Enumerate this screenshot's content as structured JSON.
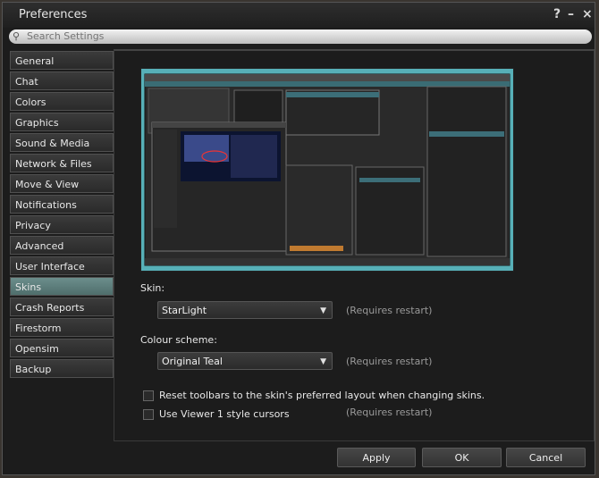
{
  "window": {
    "title": "Preferences",
    "help_button": "?",
    "minimize_button": "–",
    "close_button": "×"
  },
  "search": {
    "placeholder": "Search Settings"
  },
  "sidebar": {
    "tabs": [
      {
        "label": "General"
      },
      {
        "label": "Chat"
      },
      {
        "label": "Colors"
      },
      {
        "label": "Graphics"
      },
      {
        "label": "Sound & Media"
      },
      {
        "label": "Network & Files"
      },
      {
        "label": "Move & View"
      },
      {
        "label": "Notifications"
      },
      {
        "label": "Privacy"
      },
      {
        "label": "Advanced"
      },
      {
        "label": "User Interface"
      },
      {
        "label": "Skins"
      },
      {
        "label": "Crash Reports"
      },
      {
        "label": "Firestorm"
      },
      {
        "label": "Opensim"
      },
      {
        "label": "Backup"
      }
    ],
    "active": "Skins"
  },
  "skins_panel": {
    "skin_label": "Skin:",
    "skin_value": "StarLight",
    "skin_note": "(Requires restart)",
    "scheme_label": "Colour scheme:",
    "scheme_value": "Original Teal",
    "scheme_note": "(Requires restart)",
    "reset_toolbars_label": "Reset toolbars to the skin's preferred layout when changing skins.",
    "reset_toolbars_checked": false,
    "viewer1_cursors_label": "Use Viewer 1 style cursors",
    "viewer1_cursors_checked": false,
    "viewer1_cursors_note": "(Requires restart)"
  },
  "footer": {
    "apply_label": "Apply",
    "ok_label": "OK",
    "cancel_label": "Cancel"
  },
  "colors": {
    "active_tab": "#5d7e7c",
    "preview_bg": "#57b0b8"
  }
}
